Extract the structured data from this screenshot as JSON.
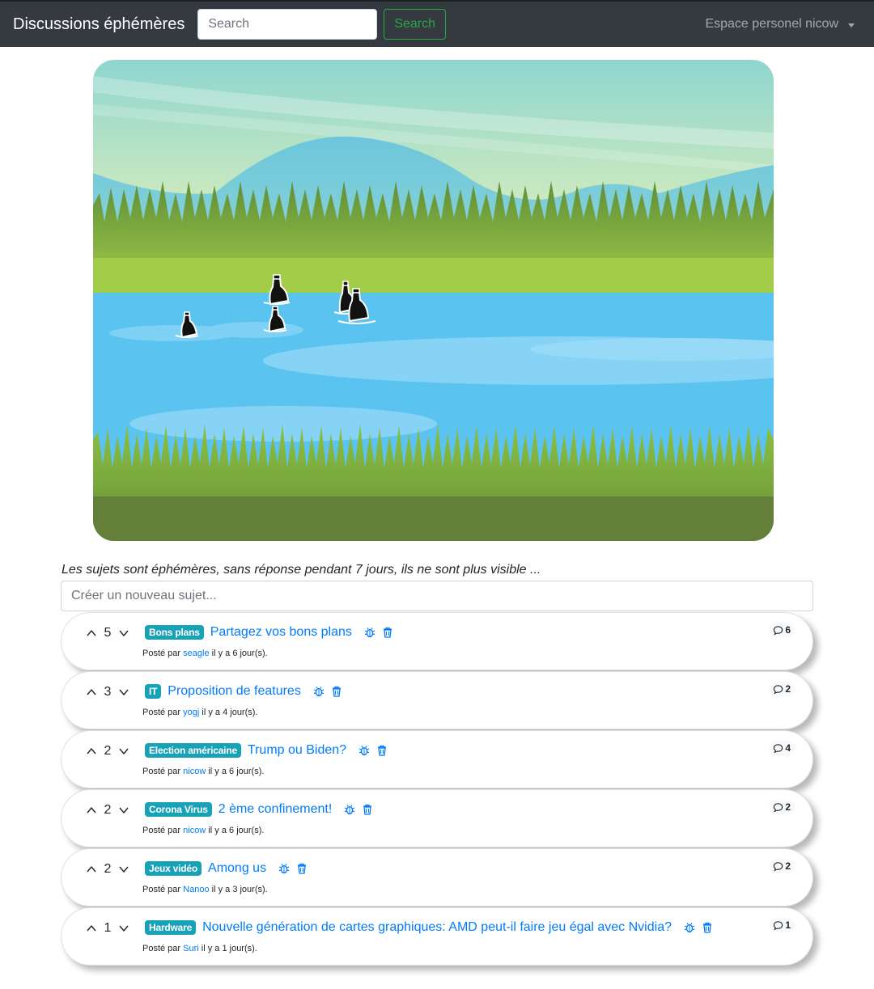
{
  "navbar": {
    "brand": "Discussions éphémères",
    "search_placeholder": "Search",
    "search_button": "Search",
    "user_menu": "Espace personel nicow"
  },
  "intro": "Les sujets sont éphémères, sans réponse pendant 7 jours, ils ne sont plus visible ...",
  "new_topic_placeholder": "Créer un nouveau sujet...",
  "topics": [
    {
      "score": "5",
      "tag": "Bons plans",
      "title": "Partagez vos bons plans",
      "posted_by": "Posté par",
      "author": "seagle",
      "when": "il y a 6 jour(s).",
      "comments": "6"
    },
    {
      "score": "3",
      "tag": "IT",
      "title": "Proposition de features",
      "posted_by": "Posté par",
      "author": "yogj",
      "when": "il y a 4 jour(s).",
      "comments": "2"
    },
    {
      "score": "2",
      "tag": "Election américaine",
      "title": "Trump ou Biden?",
      "posted_by": "Posté par",
      "author": "nicow",
      "when": "il y a 6 jour(s).",
      "comments": "4"
    },
    {
      "score": "2",
      "tag": "Corona Virus",
      "title": "2 ème confinement!",
      "posted_by": "Posté par",
      "author": "nicow",
      "when": "il y a 6 jour(s).",
      "comments": "2"
    },
    {
      "score": "2",
      "tag": "Jeux vidéo",
      "title": "Among us",
      "posted_by": "Posté par",
      "author": "Nanoo",
      "when": "il y a 3 jour(s).",
      "comments": "2"
    },
    {
      "score": "1",
      "tag": "Hardware",
      "title": "Nouvelle génération de cartes graphiques: AMD peut-il faire jeu égal avec Nvidia?",
      "posted_by": "Posté par",
      "author": "Suri",
      "when": "il y a 1 jour(s).",
      "comments": "1"
    }
  ],
  "icons": {
    "upvote": "chevron-up-icon",
    "downvote": "chevron-down-icon",
    "report": "bug-icon",
    "delete": "trash-icon",
    "comments": "speech-bubble-icon",
    "bottle": "bottle-icon"
  },
  "colors": {
    "navbar": "#343a40",
    "success": "#28a745",
    "badge": "#17a2b8",
    "link": "#007bff",
    "water": "#5bc3f0",
    "grass": "#8cbb3f"
  }
}
